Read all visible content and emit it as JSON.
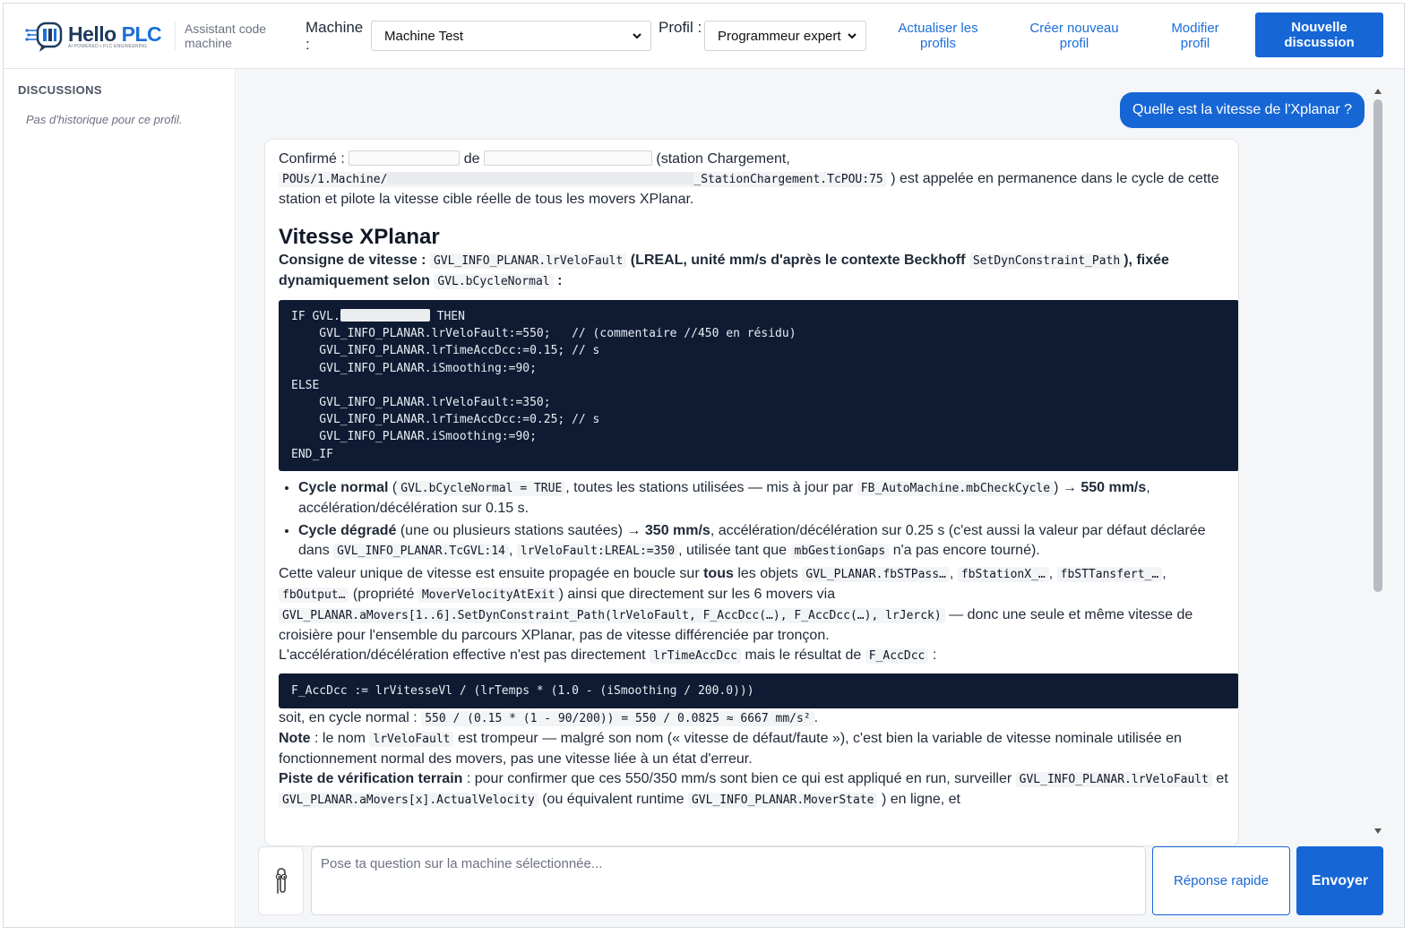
{
  "header": {
    "logo": {
      "brand_hello": "Hello",
      "brand_plc": "PLC",
      "tagline": "AI POWERED • PLC ENGINEERING"
    },
    "assistant_label": "Assistant code machine",
    "machine_label": "Machine :",
    "machine_value": "Machine Test",
    "profile_label": "Profil :",
    "profile_value": "Programmeur expert",
    "refresh_profiles": "Actualiser les profils",
    "create_profile": "Créer nouveau profil",
    "edit_profile": "Modifier profil",
    "new_discussion": "Nouvelle discussion"
  },
  "sidebar": {
    "title": "DISCUSSIONS",
    "empty_text": "Pas d'historique pour ce profil."
  },
  "chat": {
    "user_question": "Quelle est la vitesse de l'Xplanar ?",
    "answer": {
      "p1_start": "Confirmé :",
      "p1_de": "de",
      "p1_station": "(station Chargement,",
      "p1_path_a": "POUs/1.Machine/",
      "p1_path_b": "_StationChargement.TcPOU:75",
      "p1_rest": ") est appelée en permanence dans le cycle de cette station et pilote la vitesse cible réelle de tous les movers XPlanar.",
      "heading": "Vitesse XPlanar",
      "consigne_label": "Consigne de vitesse :",
      "consigne_var": "GVL_INFO_PLANAR.lrVeloFault",
      "consigne_mid": "(LREAL, unité mm/s d'après le contexte Beckhoff",
      "consigne_fn": "SetDynConstraint_Path",
      "consigne_end": "), fixée dynamiquement selon",
      "consigne_cond": "GVL.bCycleNormal",
      "consigne_colon": ":",
      "code1_if": "IF GVL.",
      "code1_then": " THEN",
      "code1_rest": "    GVL_INFO_PLANAR.lrVeloFault:=550;   // (commentaire //450 en résidu)\n    GVL_INFO_PLANAR.lrTimeAccDcc:=0.15; // s\n    GVL_INFO_PLANAR.iSmoothing:=90;\nELSE\n    GVL_INFO_PLANAR.lrVeloFault:=350;\n    GVL_INFO_PLANAR.lrTimeAccDcc:=0.25; // s\n    GVL_INFO_PLANAR.iSmoothing:=90;\nEND_IF",
      "b1_title": "Cycle normal",
      "b1_code1": "GVL.bCycleNormal = TRUE",
      "b1_mid": ", toutes les stations utilisées — mis à jour par",
      "b1_code2": "FB_AutoMachine.mbCheckCycle",
      "b1_arrow": ") →",
      "b1_speed": "550 mm/s",
      "b1_end": ", accélération/décélération sur 0.15 s.",
      "b2_title": "Cycle dégradé",
      "b2_mid": "(une ou plusieurs stations sautées) →",
      "b2_speed": "350 mm/s",
      "b2_text": ", accélération/décélération sur 0.25 s (c'est aussi la valeur par défaut déclarée dans",
      "b2_code1": "GVL_INFO_PLANAR.TcGVL:14",
      "b2_code2": "lrVeloFault:LREAL:=350",
      "b2_text2": ", utilisée tant que",
      "b2_code3": "mbGestionGaps",
      "b2_end": "n'a pas encore tourné).",
      "p3_start": "Cette valeur unique de vitesse est ensuite propagée en boucle sur",
      "p3_tous": "tous",
      "p3_objs": "les objets",
      "p3_c1": "GVL_PLANAR.fbSTPass…",
      "p3_c2": "fbStationX_…",
      "p3_c3": "fbSTTansfert_…",
      "p3_c4": "fbOutput…",
      "p3_prop": "(propriété",
      "p3_c5": "MoverVelocityAtExit",
      "p3_mid": ") ainsi que directement sur les 6 movers via",
      "p3_c6": "GVL_PLANAR.aMovers[1..6].SetDynConstraint_Path(lrVeloFault, F_AccDcc(…), F_AccDcc(…), lrJerck)",
      "p3_end": "— donc une seule et même vitesse de croisière pour l'ensemble du parcours XPlanar, pas de vitesse différenciée par tronçon.",
      "p4_start": "L'accélération/décélération effective n'est pas directement",
      "p4_c1": "lrTimeAccDcc",
      "p4_mid": "mais le résultat de",
      "p4_c2": "F_AccDcc",
      "p4_end": ":",
      "code2": "F_AccDcc := lrVitesseVl / (lrTemps * (1.0 - (iSmoothing / 200.0)))",
      "p5_start": "soit, en cycle normal :",
      "p5_code": "550 / (0.15 * (1 - 90/200)) = 550 / 0.0825 ≈ 6667 mm/s²",
      "p5_end": ".",
      "note_label": "Note",
      "note_a": ": le nom",
      "note_code": "lrVeloFault",
      "note_b": "est trompeur — malgré son nom (« vitesse de défaut/faute »), c'est bien la variable de vitesse nominale utilisée en fonctionnement normal des movers, pas une vitesse liée à un état d'erreur.",
      "piste_label": "Piste de vérification terrain",
      "piste_text": ": pour confirmer que ces 550/350 mm/s sont bien ce qui est appliqué en run, surveiller",
      "piste_c1": "GVL_INFO_PLANAR.lrVeloFault",
      "piste_et": "et",
      "piste_c2": "GVL_PLANAR.aMovers[x].ActualVelocity",
      "piste_mid": "(ou équivalent runtime",
      "piste_c3": "GVL_INFO_PLANAR.MoverState",
      "piste_end": ") en ligne, et"
    }
  },
  "composer": {
    "placeholder": "Pose ta question sur la machine sélectionnée...",
    "quick_reply": "Réponse rapide",
    "send": "Envoyer"
  },
  "colors": {
    "accent": "#1666d6",
    "code_bg": "#0f1b33",
    "main_bg": "#f4f6f8"
  }
}
